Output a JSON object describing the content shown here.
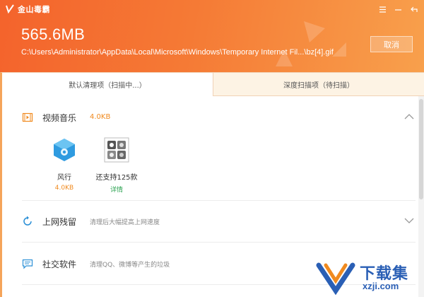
{
  "app": {
    "logo_text": "金山毒霸"
  },
  "header": {
    "size": "565.6MB",
    "path": "C:\\Users\\Administrator\\AppData\\Local\\Microsoft\\Windows\\Temporary Internet Fil...\\bz[4].gif",
    "cancel_label": "取消"
  },
  "tabs": [
    {
      "label": "默认清理项（扫描中...）"
    },
    {
      "label": "深度扫描项（待扫描）"
    }
  ],
  "sections": [
    {
      "title": "视频音乐",
      "size": "4.0KB"
    },
    {
      "title": "上网残留",
      "desc": "清理后大幅提高上网速度"
    },
    {
      "title": "社交软件",
      "desc": "清理QQ、微博等产生的垃圾"
    }
  ],
  "items": [
    {
      "name": "风行",
      "value": "4.0KB"
    },
    {
      "name": "还支持125款",
      "value": "详情"
    }
  ],
  "watermark": {
    "text": "下载集",
    "sub": "xzji.com"
  },
  "colors": {
    "accent": "#f4632c",
    "size_orange": "#f08a1f",
    "link_green": "#2ca352",
    "watermark_blue": "#2a5fb5"
  },
  "icons": [
    "fengxing-app-icon",
    "more-apps-grid-icon",
    "video-music-icon",
    "web-residue-icon",
    "social-software-icon",
    "chevron-up-icon",
    "chevron-down-icon",
    "menu-icon",
    "minimize-icon",
    "back-icon"
  ]
}
